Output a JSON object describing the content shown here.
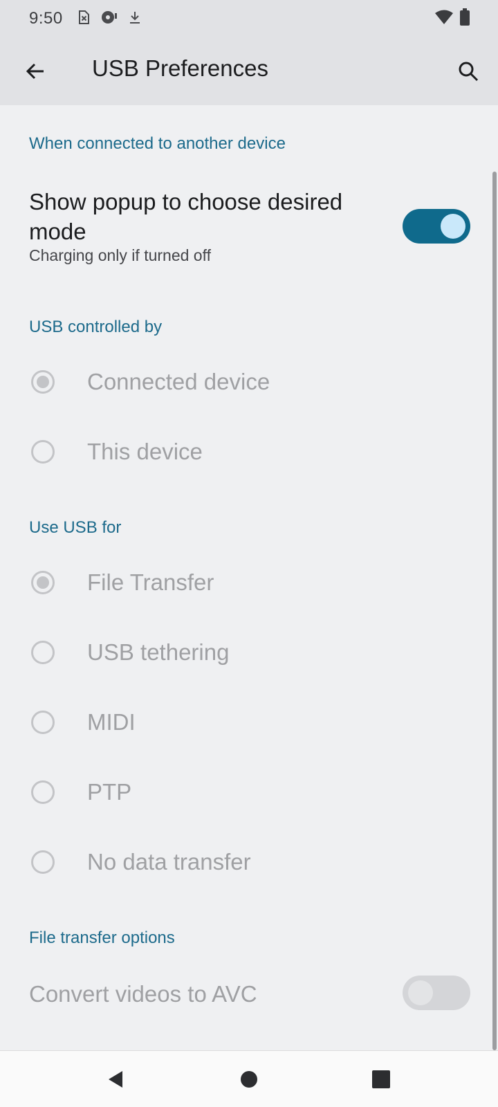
{
  "status_bar": {
    "time": "9:50",
    "left_icons": [
      "sim-error-icon",
      "media-icon",
      "download-icon"
    ],
    "right_icons": [
      "wifi-icon",
      "battery-icon"
    ]
  },
  "app_bar": {
    "title": "USB Preferences",
    "back_icon": "arrow-back-icon",
    "search_icon": "search-icon"
  },
  "sections": {
    "connected": {
      "header": "When connected to another device",
      "popup_title": "Show popup to choose desired mode",
      "popup_summary": "Charging only if turned off",
      "popup_toggle_on": true
    },
    "controlled_by": {
      "header": "USB controlled by",
      "options": [
        {
          "label": "Connected device",
          "checked": true
        },
        {
          "label": "This device",
          "checked": false
        }
      ]
    },
    "use_usb_for": {
      "header": "Use USB for",
      "options": [
        {
          "label": "File Transfer",
          "checked": true
        },
        {
          "label": "USB tethering",
          "checked": false
        },
        {
          "label": "MIDI",
          "checked": false
        },
        {
          "label": "PTP",
          "checked": false
        },
        {
          "label": "No data transfer",
          "checked": false
        }
      ]
    },
    "file_transfer_options": {
      "header": "File transfer options",
      "convert_title": "Convert videos to AVC",
      "convert_toggle_on": false
    }
  },
  "nav_bar": {
    "back": "nav-back-icon",
    "home": "nav-home-icon",
    "recents": "nav-recents-icon"
  },
  "colors": {
    "accent": "#0f6a8c",
    "section_header": "#1c6a8b",
    "disabled_text": "#9fa0a3"
  }
}
